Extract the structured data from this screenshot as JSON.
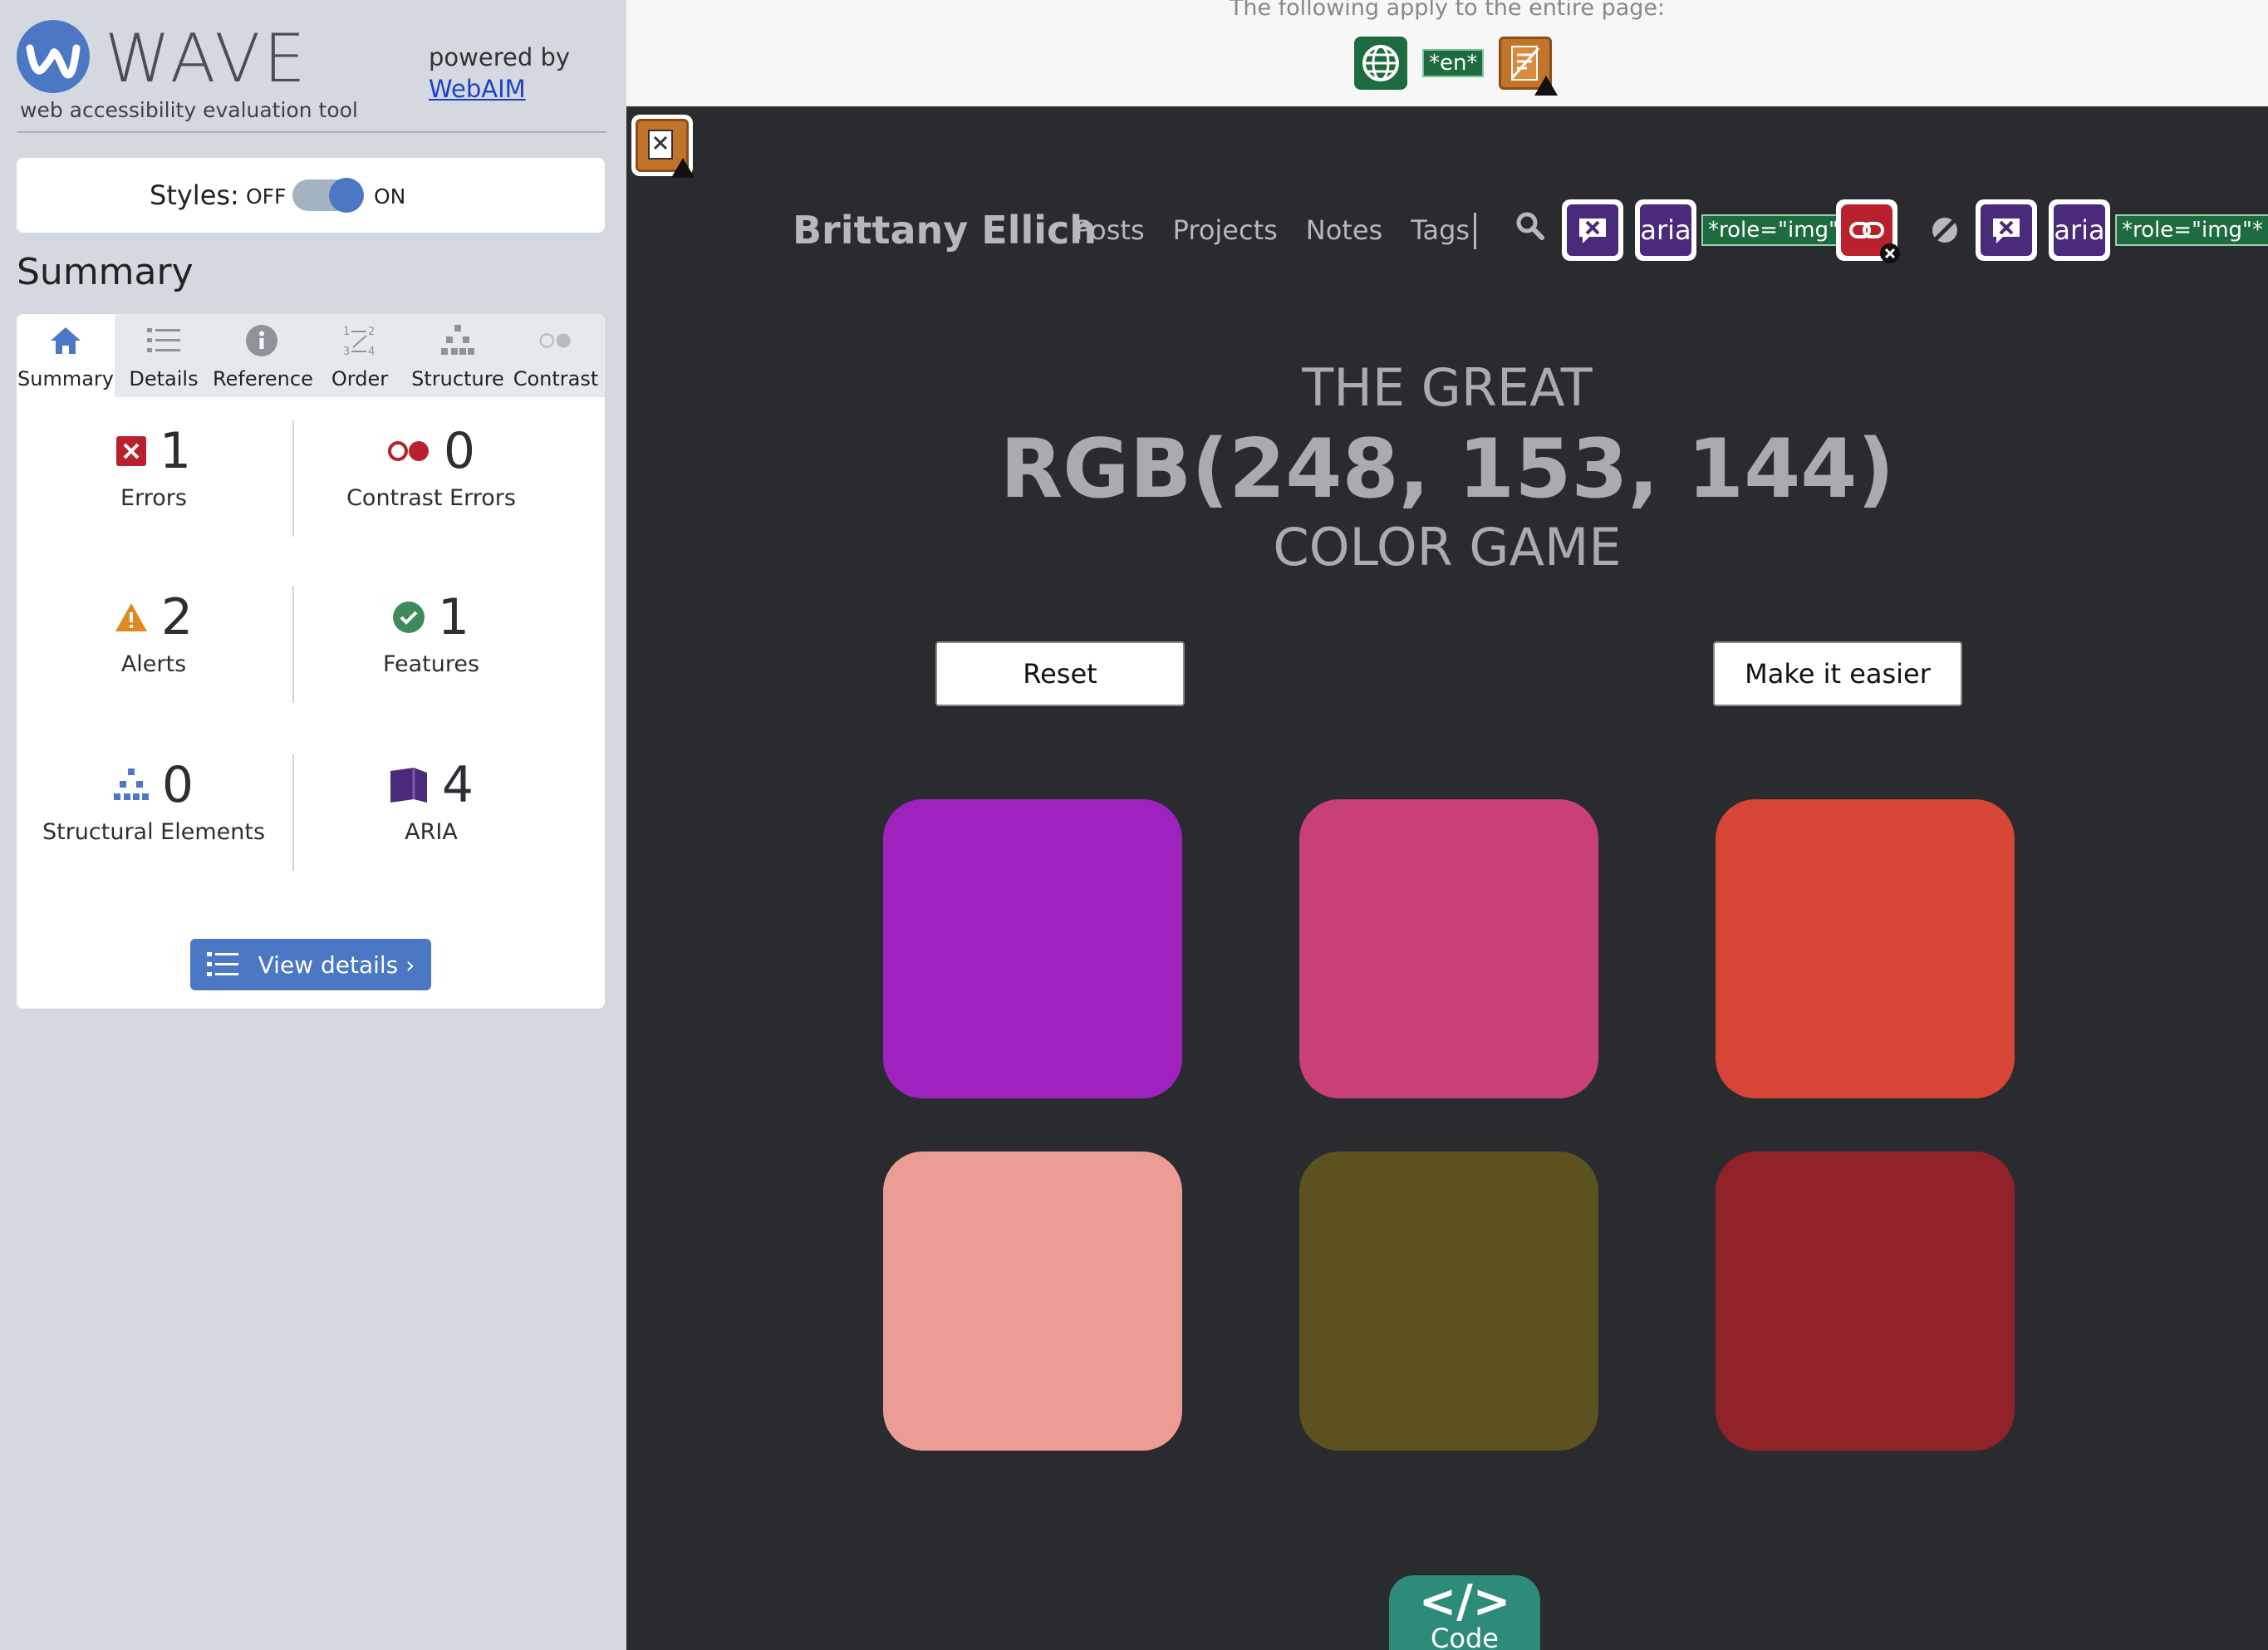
{
  "wave": {
    "name": "WAVE",
    "subtitle": "web accessibility evaluation tool",
    "powered_by": "powered by",
    "webaim": "WebAIM",
    "styles_label": "Styles:",
    "off": "OFF",
    "on": "ON",
    "styles_on": true,
    "summary_title": "Summary",
    "tabs": [
      {
        "label": "Summary",
        "icon": "home-icon",
        "active": true
      },
      {
        "label": "Details",
        "icon": "list-icon"
      },
      {
        "label": "Reference",
        "icon": "info-icon"
      },
      {
        "label": "Order",
        "icon": "order-icon"
      },
      {
        "label": "Structure",
        "icon": "structure-icon"
      },
      {
        "label": "Contrast",
        "icon": "contrast-icon"
      }
    ],
    "stats": {
      "errors": {
        "count": "1",
        "label": "Errors"
      },
      "contrast_errors": {
        "count": "0",
        "label": "Contrast Errors"
      },
      "alerts": {
        "count": "2",
        "label": "Alerts"
      },
      "features": {
        "count": "1",
        "label": "Features"
      },
      "structural": {
        "count": "0",
        "label": "Structural Elements"
      },
      "aria": {
        "count": "4",
        "label": "ARIA"
      }
    },
    "view_details": "View details ›",
    "colors": {
      "accent": "#4b77c4",
      "error": "#b8212b",
      "alert": "#e08a1e",
      "feature": "#3f8a5d",
      "aria": "#4a2a7a"
    }
  },
  "page": {
    "apply_text": "The following apply to the entire page:",
    "lang_tag": "*en*",
    "site_name": "Brittany Ellich",
    "nav": [
      "Posts",
      "Projects",
      "Notes",
      "Tags"
    ],
    "aria_label": "aria",
    "role_tag": "*role=\"img\"*",
    "title_top": "THE GREAT",
    "title_rgb": "RGB(248, 153, 144)",
    "title_bottom": "COLOR GAME",
    "reset": "Reset",
    "easier": "Make it easier",
    "tiles": [
      "#a022be",
      "#c93f78",
      "#d64535",
      "#ec9c94",
      "#5b5220",
      "#912229"
    ],
    "code_glyph": "</>",
    "code_label": "Code"
  }
}
